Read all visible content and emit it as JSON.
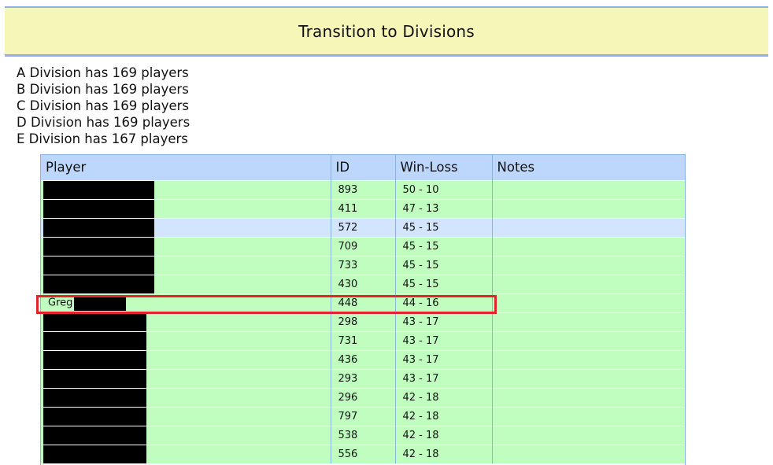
{
  "banner": {
    "title": "Transition to Divisions"
  },
  "summary": [
    "A Division has 169 players",
    "B Division has 169 players",
    "C Division has 169 players",
    "D Division has 169 players",
    "E Division has 167 players"
  ],
  "table": {
    "headers": {
      "player": "Player",
      "id": "ID",
      "win_loss": "Win-Loss",
      "notes": "Notes"
    },
    "rows": [
      {
        "player": "",
        "id": "893",
        "win_loss": "50 - 10",
        "notes": ""
      },
      {
        "player": "",
        "id": "411",
        "win_loss": "47 - 13",
        "notes": ""
      },
      {
        "player": "",
        "id": "572",
        "win_loss": "45 - 15",
        "notes": ""
      },
      {
        "player": "",
        "id": "709",
        "win_loss": "45 - 15",
        "notes": ""
      },
      {
        "player": "",
        "id": "733",
        "win_loss": "45 - 15",
        "notes": ""
      },
      {
        "player": "",
        "id": "430",
        "win_loss": "45 - 15",
        "notes": ""
      },
      {
        "player": "Greg",
        "id": "448",
        "win_loss": "44 - 16",
        "notes": ""
      },
      {
        "player": "",
        "id": "298",
        "win_loss": "43 - 17",
        "notes": ""
      },
      {
        "player": "",
        "id": "731",
        "win_loss": "43 - 17",
        "notes": ""
      },
      {
        "player": "",
        "id": "436",
        "win_loss": "43 - 17",
        "notes": ""
      },
      {
        "player": "",
        "id": "293",
        "win_loss": "43 - 17",
        "notes": ""
      },
      {
        "player": "",
        "id": "296",
        "win_loss": "42 - 18",
        "notes": ""
      },
      {
        "player": "",
        "id": "797",
        "win_loss": "42 - 18",
        "notes": ""
      },
      {
        "player": "",
        "id": "538",
        "win_loss": "42 - 18",
        "notes": ""
      },
      {
        "player": "",
        "id": "556",
        "win_loss": "42 - 18",
        "notes": ""
      }
    ]
  },
  "colors": {
    "banner_bg": "#f6f6b9",
    "border_blue": "#8cb2e3",
    "header_bg": "#bcd7fb",
    "row_green": "#c0fec0",
    "row_hover_blue": "#d3e4fd",
    "highlight_red": "#e4222a"
  }
}
